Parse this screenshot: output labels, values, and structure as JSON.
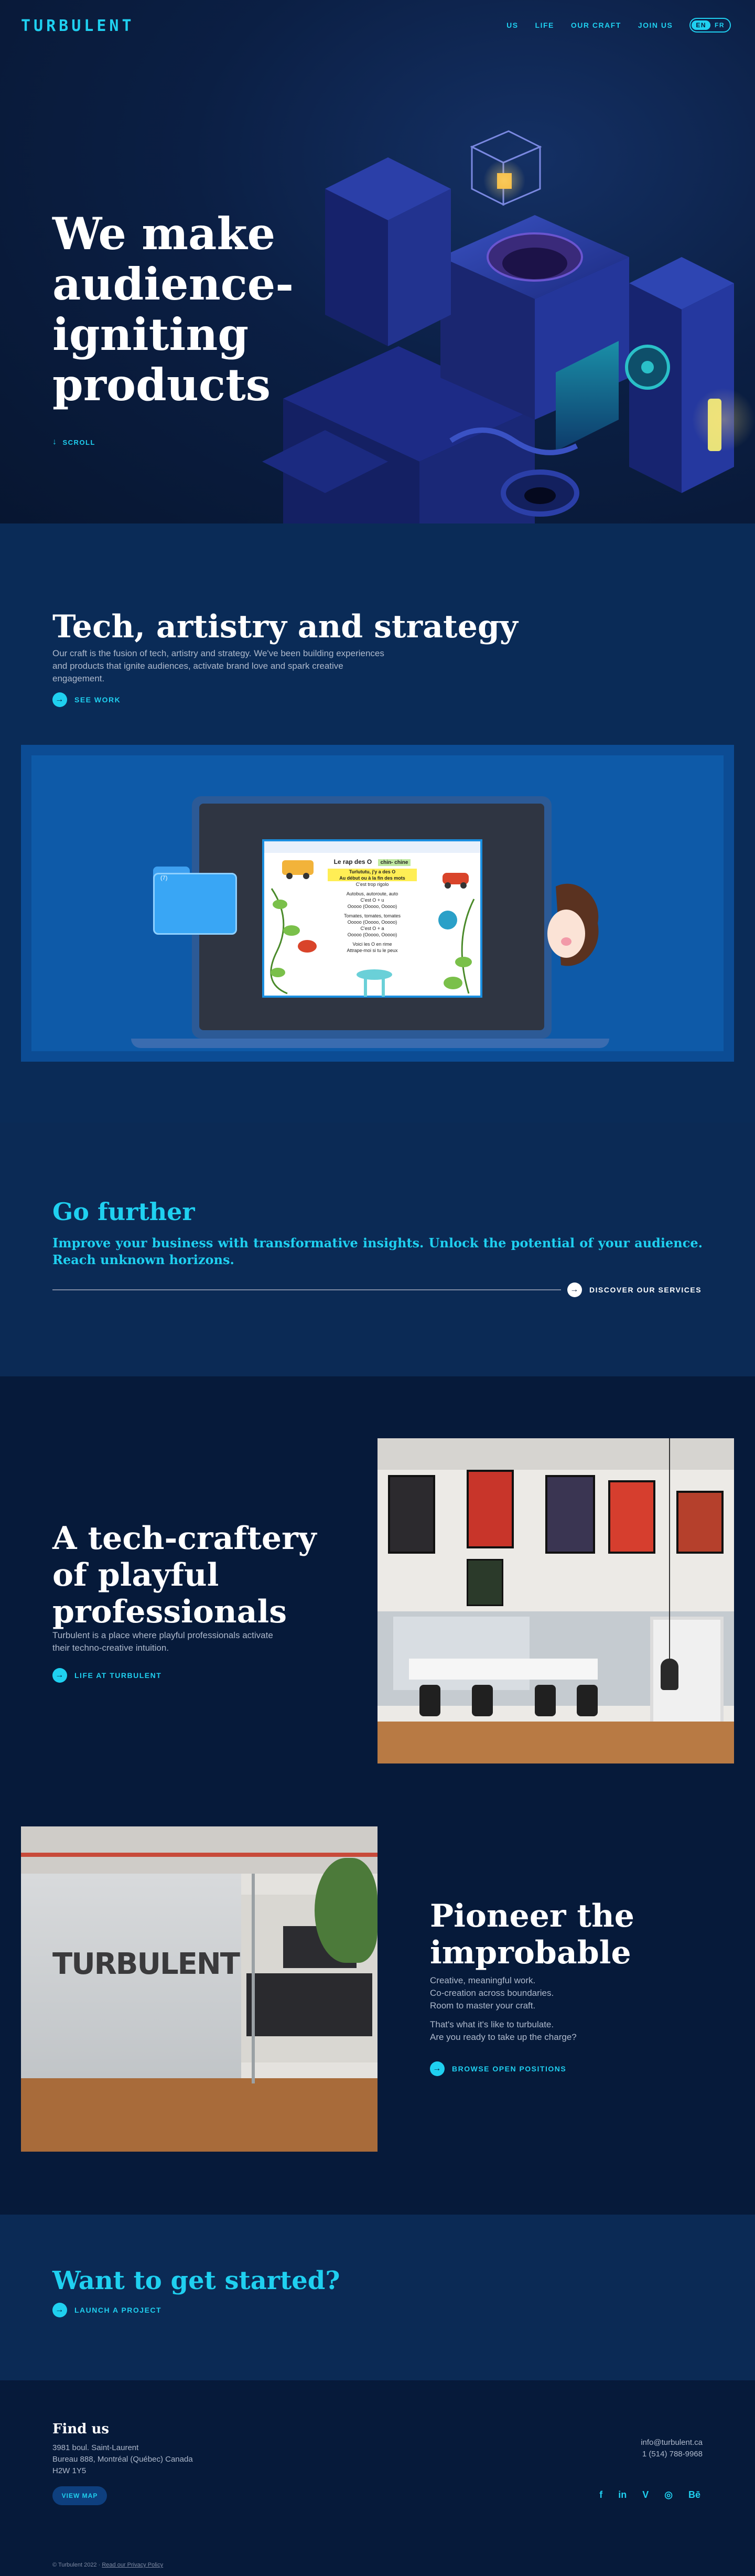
{
  "nav": {
    "logo": "TURBULENT",
    "links": [
      "US",
      "LIFE",
      "OUR CRAFT",
      "JOIN US"
    ],
    "lang_active": "EN",
    "lang_other": "FR"
  },
  "hero": {
    "title_line1": "We make audience-",
    "title_line2": "igniting products",
    "scroll_label": "SCROLL"
  },
  "tech": {
    "title": "Tech, artistry and strategy",
    "body": "Our craft is the fusion of tech, artistry and strategy. We've been building experiences and products that ignite audiences, activate brand love and spark creative engagement.",
    "cta": "SEE WORK"
  },
  "work_preview": {
    "folder_label": "(7)",
    "screen_title": "Le rap des O",
    "screen_badge": "chin- chine",
    "lines": [
      "Turlututu, j'y a des O",
      "Au début ou à la fin des mots",
      "C'est trop rigolo",
      "Autobus, autoroute, auto",
      "C'est O + u",
      "Ooooo (Ooooo, Ooooo)",
      "Tomates, tomates, tomates",
      "Ooooo (Ooooo, Ooooo)",
      "C'est O + a",
      "Ooooo (Ooooo, Ooooo)",
      "Voici les O en rime",
      "Attrape-moi si tu le peux"
    ]
  },
  "further": {
    "title": "Go further",
    "body": "Improve your business with transformative insights. Unlock the potential of your audience. Reach unknown horizons.",
    "cta": "DISCOVER OUR SERVICES"
  },
  "craftery": {
    "title_line1": "A tech-craftery",
    "title_line2": "of playful",
    "title_line3": "professionals",
    "body": "Turbulent is a place where playful professionals activate their techno-creative intuition.",
    "cta": "LIFE AT TURBULENT"
  },
  "pioneer": {
    "title_line1": "Pioneer the",
    "title_line2": "improbable",
    "line1": "Creative, meaningful work.",
    "line2": "Co-creation across boundaries.",
    "line3": "Room to master your craft.",
    "line4": "That's what it's like to turbulate.",
    "line5": "Are you ready to take up the charge?",
    "cta": "BROWSE OPEN POSITIONS",
    "glass_logo": "TURBULENT"
  },
  "start": {
    "title": "Want to get started?",
    "cta": "LAUNCH A PROJECT"
  },
  "footer": {
    "heading": "Find us",
    "address1": "3981 boul. Saint-Laurent",
    "address2": "Bureau 888, Montréal (Québec) Canada",
    "address3": "H2W 1Y5",
    "email": "info@turbulent.ca",
    "phone": "1 (514) 788-9968",
    "map_button": "VIEW MAP",
    "copyright": "© Turbulent 2022 ·",
    "privacy": "Read our Privacy Policy",
    "social": [
      "f",
      "in",
      "V",
      "◎",
      "Bē"
    ]
  },
  "colors": {
    "accent": "#1fd0f0",
    "background": "#061a3a",
    "section": "#0b2a55"
  }
}
